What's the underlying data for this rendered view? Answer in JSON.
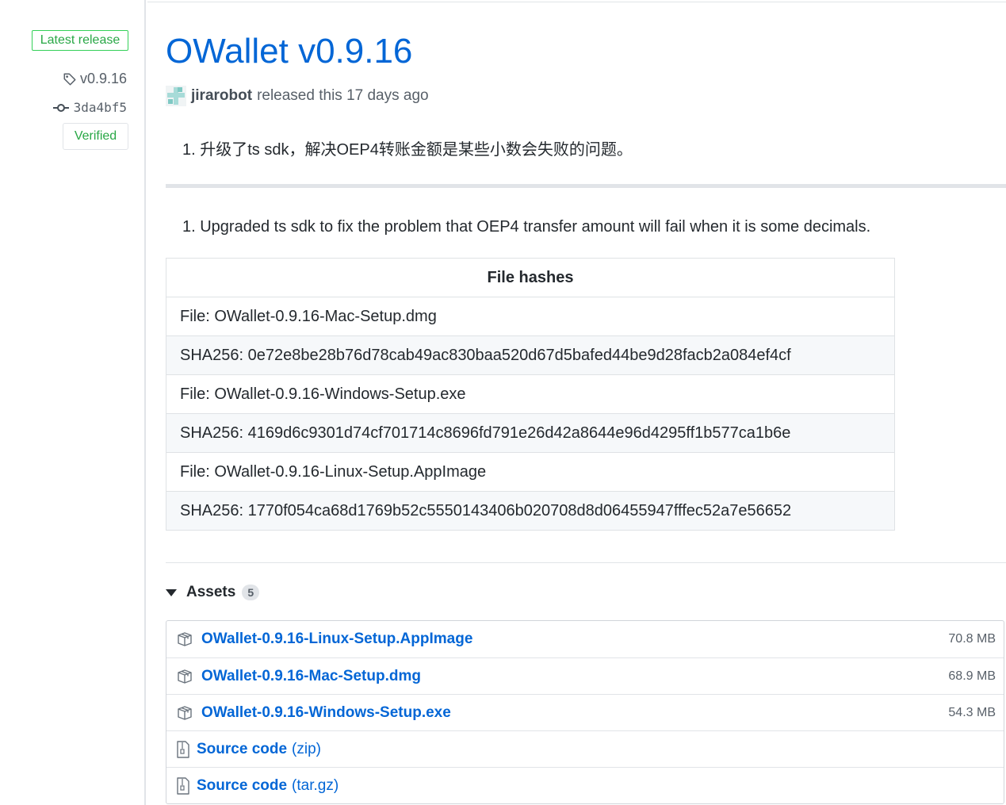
{
  "sidebar": {
    "latest_label": "Latest release",
    "tag": "v0.9.16",
    "commit": "3da4bf5",
    "verified_label": "Verified"
  },
  "release": {
    "title": "OWallet v0.9.16",
    "author": "jirarobot",
    "released_text": "released this 17 days ago",
    "notes_zh": "1. 升级了ts sdk，解决OEP4转账金额是某些小数会失败的问题。",
    "notes_en": "1. Upgraded ts sdk to fix the problem that OEP4 transfer amount will fail when it is some decimals."
  },
  "hashes_table": {
    "header": "File hashes",
    "rows": [
      "File: OWallet-0.9.16-Mac-Setup.dmg",
      "SHA256: 0e72e8be28b76d78cab49ac830baa520d67d5bafed44be9d28facb2a084ef4cf",
      "File: OWallet-0.9.16-Windows-Setup.exe",
      "SHA256: 4169d6c9301d74cf701714c8696fd791e26d42a8644e96d4295ff1b577ca1b6e",
      "File: OWallet-0.9.16-Linux-Setup.AppImage",
      "SHA256: 1770f054ca68d1769b52c5550143406b020708d8d06455947fffec52a7e56652"
    ]
  },
  "assets": {
    "label": "Assets",
    "count": "5",
    "items": [
      {
        "name": "OWallet-0.9.16-Linux-Setup.AppImage",
        "size": "70.8 MB",
        "icon": "package-icon"
      },
      {
        "name": "OWallet-0.9.16-Mac-Setup.dmg",
        "size": "68.9 MB",
        "icon": "package-icon"
      },
      {
        "name": "OWallet-0.9.16-Windows-Setup.exe",
        "size": "54.3 MB",
        "icon": "package-icon"
      },
      {
        "name": "Source code",
        "suffix": "(zip)",
        "icon": "file-zip-icon"
      },
      {
        "name": "Source code",
        "suffix": "(tar.gz)",
        "icon": "file-zip-icon"
      }
    ]
  },
  "colors": {
    "link": "#0366d6",
    "verified_green": "#28a745",
    "muted": "#586069"
  }
}
